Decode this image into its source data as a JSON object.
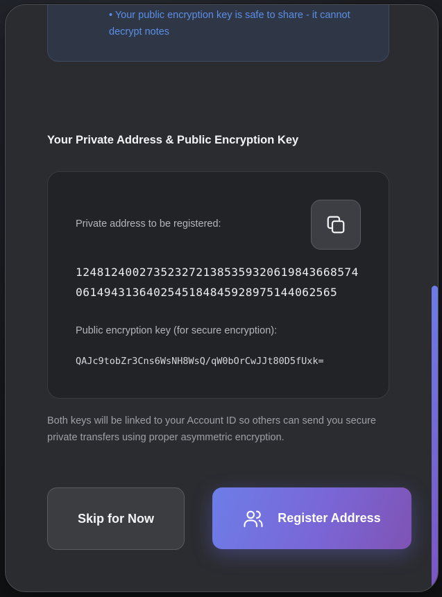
{
  "info_box": {
    "bullet": "• Your public encryption key is safe to share - it cannot decrypt notes"
  },
  "section_title": "Your Private Address & Public Encryption Key",
  "key_card": {
    "address_label": "Private address to be registered:",
    "address_lines": [
      "1248124002735232721385359320619843668574",
      "0614943136402545184845928975144062565"
    ],
    "pubkey_label": "Public encryption key (for secure encryption):",
    "pubkey_value": "QAJc9tobZr3Cns6WsNH8WsQ/qW0bOrCwJJt80D5fUxk=",
    "copy_icon": "copy-icon"
  },
  "explanation": "Both keys will be linked to your Account ID so others can send you secure private transfers using proper asymmetric encryption.",
  "buttons": {
    "skip_label": "Skip for Now",
    "register_label": "Register Address",
    "register_icon": "users-icon"
  },
  "colors": {
    "accent_start": "#6d7de8",
    "accent_end": "#7f53b4",
    "link_blue": "#5b8fe6"
  }
}
